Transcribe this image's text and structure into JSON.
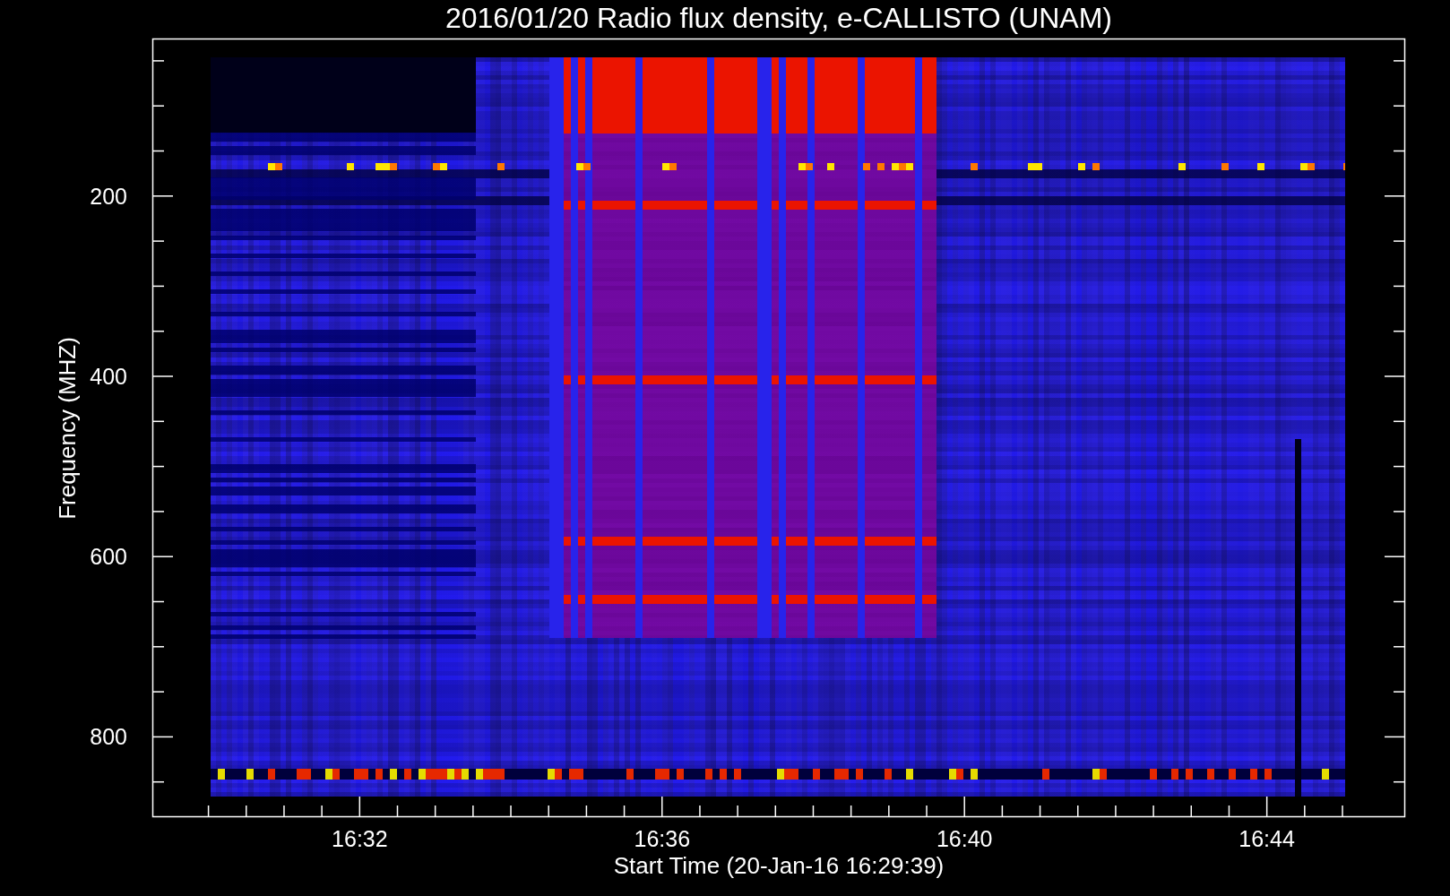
{
  "title": "2016/01/20  Radio flux density, e-CALLISTO (UNAM)",
  "y_axis": {
    "label": "Frequency (MHZ)",
    "tick_labels": [
      "200",
      "400",
      "600",
      "800"
    ]
  },
  "x_axis": {
    "label": "Start Time (20-Jan-16 16:29:39)",
    "tick_labels": [
      "16:32",
      "16:36",
      "16:40",
      "16:44"
    ]
  }
}
